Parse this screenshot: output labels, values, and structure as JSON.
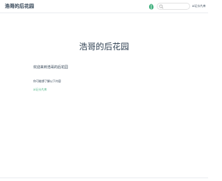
{
  "navbar": {
    "site_name": "浩哥的后花园",
    "search": {
      "placeholder": "",
      "value": ""
    },
    "link_label": "ai记卡片库"
  },
  "hero": {
    "title": "浩哥的后花园"
  },
  "content": {
    "welcome": "欢迎来到浩哥的后花园",
    "intro": "你可能想了解以下内容",
    "link": "ai记卡片库"
  },
  "colors": {
    "accent": "#3eaf7c",
    "text": "#2c3e50",
    "border": "#eaecef"
  },
  "icons": {
    "theme_toggle": "theme-toggle-icon",
    "search": "search-icon"
  }
}
